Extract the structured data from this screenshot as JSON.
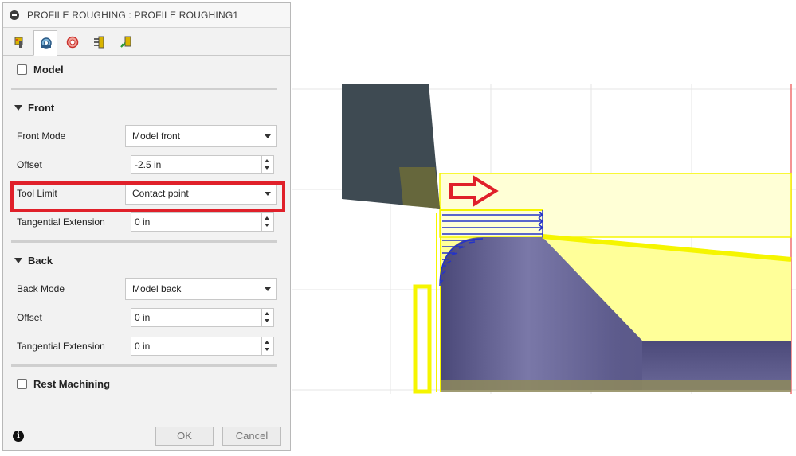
{
  "dialog": {
    "title": "PROFILE ROUGHING : PROFILE ROUGHING1",
    "tabs": [
      {
        "icon": "tool-icon",
        "active": false
      },
      {
        "icon": "geometry-icon",
        "active": true
      },
      {
        "icon": "radii-icon",
        "active": false
      },
      {
        "icon": "passes-icon",
        "active": false
      },
      {
        "icon": "linking-icon",
        "active": false
      }
    ],
    "model": {
      "label": "Model",
      "checked": false
    },
    "front": {
      "header": "Front",
      "mode_label": "Front Mode",
      "mode_value": "Model front",
      "offset_label": "Offset",
      "offset_value": "-2.5 in",
      "tool_limit_label": "Tool Limit",
      "tool_limit_value": "Contact point",
      "tangential_label": "Tangential Extension",
      "tangential_value": "0 in"
    },
    "back": {
      "header": "Back",
      "mode_label": "Back Mode",
      "mode_value": "Model back",
      "offset_label": "Offset",
      "offset_value": "0 in",
      "tangential_label": "Tangential Extension",
      "tangential_value": "0 in"
    },
    "rest_machining": {
      "label": "Rest Machining",
      "checked": false
    },
    "footer": {
      "info_icon": "i",
      "ok_label": "OK",
      "cancel_label": "Cancel"
    }
  },
  "colors": {
    "highlight": "#e0202a",
    "toolpath_yellow": "#f5f500",
    "stock_fill": "#ffff99",
    "part": "#5a5888",
    "tool_holder": "#3e4a52",
    "pass_lines": "#2433c8"
  }
}
